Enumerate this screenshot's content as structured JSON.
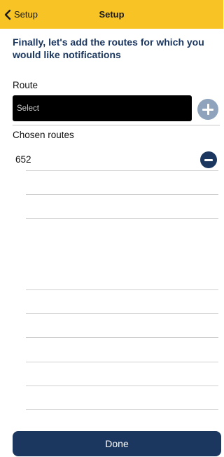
{
  "navbar": {
    "back_label": "Setup",
    "title": "Setup"
  },
  "heading": "Finally, let's add the routes for which you would like notifications",
  "route_section": {
    "label": "Route",
    "select_placeholder": "Select"
  },
  "chosen_section": {
    "label": "Chosen routes",
    "routes": [
      "652"
    ]
  },
  "done_label": "Done",
  "colors": {
    "navbar_bg": "#f7c325",
    "heading_text": "#1b3760",
    "primary_button": "#1b3760",
    "add_button": "#8fa4bc",
    "select_bg": "#000000"
  },
  "icons": {
    "back": "chevron-left-icon",
    "add": "plus-circle-icon",
    "remove": "minus-circle-icon"
  }
}
